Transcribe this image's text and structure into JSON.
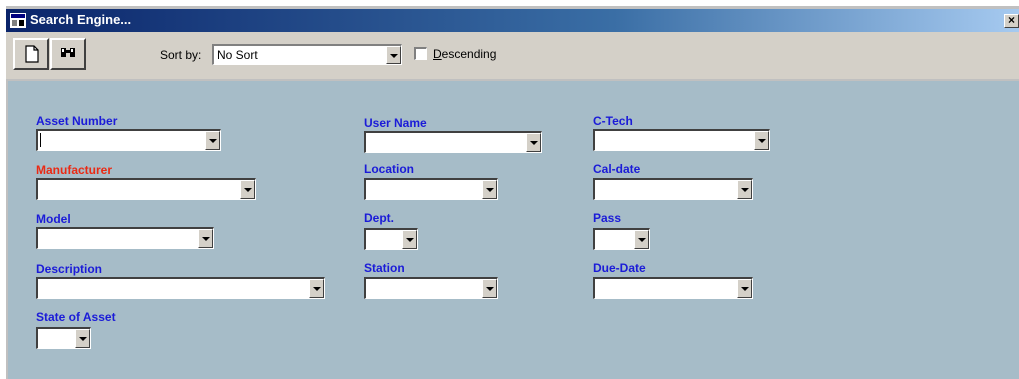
{
  "window": {
    "title": "Search Engine...",
    "close_label": "×"
  },
  "toolbar": {
    "new_icon": "new-document-icon",
    "find_icon": "binoculars-icon",
    "sort_by_label": "Sort by:",
    "sort_value": "No Sort",
    "descending_label": "Descending",
    "descending_checked": false
  },
  "fields": {
    "asset_number": "Asset Number",
    "manufacturer": "Manufacturer",
    "model": "Model",
    "description": "Description",
    "state_of_asset": "State of Asset",
    "user_name": "User Name",
    "location": "Location",
    "dept": "Dept.",
    "station": "Station",
    "c_tech": "C-Tech",
    "cal_date": "Cal-date",
    "pass": "Pass",
    "due_date": "Due-Date"
  },
  "colors": {
    "label_blue": "#1b1bd8",
    "label_red": "#ea2a14",
    "panel_bg": "#a6bcc8",
    "title_bar": "#0a246a"
  }
}
